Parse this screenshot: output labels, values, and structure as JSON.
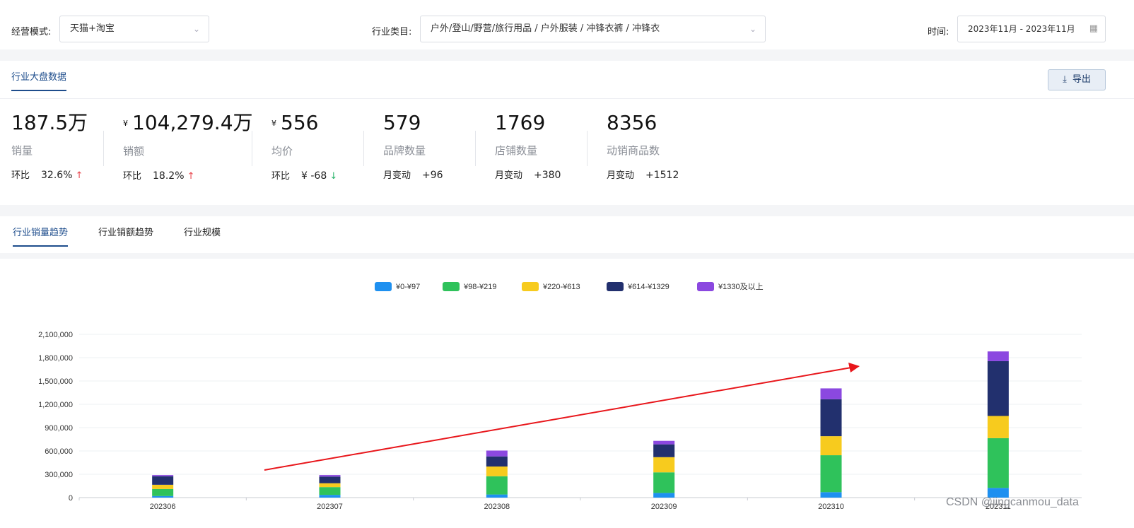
{
  "filters": {
    "mode_label": "经营模式:",
    "mode_value": "天猫+淘宝",
    "category_label": "行业类目:",
    "category_value": "户外/登山/野营/旅行用品 / 户外服装 / 冲锋衣裤 / 冲锋衣",
    "time_label": "时间:",
    "time_value": "2023年11月 - 2023年11月"
  },
  "overview": {
    "tab_label": "行业大盘数据",
    "export_label": "导出",
    "metrics": [
      {
        "value": "187.5万",
        "currency": "",
        "label": "销量",
        "change_label": "环比",
        "change_value": "32.6%",
        "arrow": "↑"
      },
      {
        "value": "104,279.4万",
        "currency": "¥",
        "label": "销额",
        "change_label": "环比",
        "change_value": "18.2%",
        "arrow": "↑"
      },
      {
        "value": "556",
        "currency": "¥",
        "label": "均价",
        "change_label": "环比",
        "change_value": "¥ -68",
        "arrow": "↓"
      },
      {
        "value": "579",
        "currency": "",
        "label": "品牌数量",
        "change_label": "月变动",
        "change_value": "+96",
        "arrow": ""
      },
      {
        "value": "1769",
        "currency": "",
        "label": "店铺数量",
        "change_label": "月变动",
        "change_value": "+380",
        "arrow": ""
      },
      {
        "value": "8356",
        "currency": "",
        "label": "动销商品数",
        "change_label": "月变动",
        "change_value": "+1512",
        "arrow": ""
      }
    ]
  },
  "trend_tabs": [
    "行业销量趋势",
    "行业销额趋势",
    "行业规模"
  ],
  "chart_data": {
    "type": "bar",
    "stacked": true,
    "categories": [
      "202306",
      "202307",
      "202308",
      "202309",
      "202310",
      "202311"
    ],
    "series": [
      {
        "name": "¥0-¥97",
        "color": "#1e90f0",
        "values": [
          20000,
          35000,
          40000,
          60000,
          70000,
          125000
        ]
      },
      {
        "name": "¥98-¥219",
        "color": "#2fc25b",
        "values": [
          90000,
          100000,
          235000,
          265000,
          475000,
          640000
        ]
      },
      {
        "name": "¥220-¥613",
        "color": "#f7cb1e",
        "values": [
          55000,
          50000,
          125000,
          195000,
          245000,
          285000
        ]
      },
      {
        "name": "¥614-¥1329",
        "color": "#22306e",
        "values": [
          110000,
          85000,
          130000,
          165000,
          475000,
          705000
        ]
      },
      {
        "name": "¥1330及以上",
        "color": "#8b48e0",
        "values": [
          15000,
          20000,
          75000,
          45000,
          140000,
          125000
        ]
      }
    ],
    "ylim": [
      0,
      2100000
    ],
    "yticks": [
      "0",
      "300,000",
      "600,000",
      "900,000",
      "1,200,000",
      "1,500,000",
      "1,800,000",
      "2,100,000"
    ],
    "legend_position": "top-center",
    "grid": true,
    "annotation": "red trend arrow rising from 202307 toward 202310"
  },
  "watermark": "CSDN @jingcanmou_data",
  "colors": {
    "accent": "#1e4d8c",
    "up": "#e8424a",
    "down": "#29b36a",
    "arrow": "#e8161b"
  }
}
